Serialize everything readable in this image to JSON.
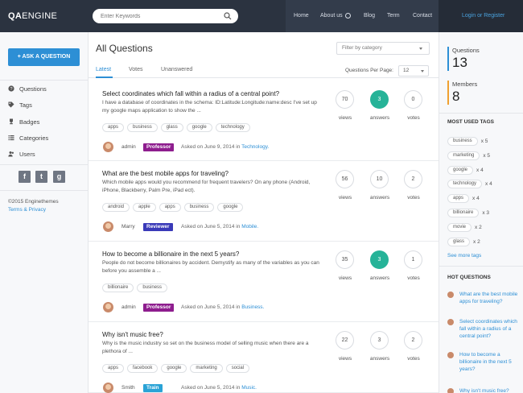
{
  "header": {
    "logo_bold": "QA",
    "logo_light": "ENGINE",
    "search_placeholder": "Enter Keywords",
    "nav": [
      "Home",
      "About us",
      "Blog",
      "Term",
      "Contact"
    ],
    "login": "Login or Register"
  },
  "sidebar": {
    "ask_button": "ASK A QUESTION",
    "items": [
      {
        "label": "Questions",
        "icon": "question-icon"
      },
      {
        "label": "Tags",
        "icon": "tag-icon"
      },
      {
        "label": "Badges",
        "icon": "trophy-icon"
      },
      {
        "label": "Categories",
        "icon": "list-icon"
      },
      {
        "label": "Users",
        "icon": "users-icon"
      }
    ],
    "social": [
      "f",
      "t",
      "g"
    ],
    "copyright": "©2015 Enginethemes",
    "terms": "Terms & Privacy"
  },
  "main": {
    "title": "All Questions",
    "filter_placeholder": "Filter by category",
    "tabs": [
      "Latest",
      "Votes",
      "Unanswered"
    ],
    "qpp_label": "Questions Per Page:",
    "qpp_value": "12",
    "questions": [
      {
        "title": "Select coordinates which fall within a radius of a central point?",
        "excerpt": "I have a database of coordinates in the schema: ID:Latitude:Longitude:name:desc I've set up my google maps application to show the ...",
        "tags": [
          "apps",
          "business",
          "glass",
          "google",
          "technology"
        ],
        "user": "admin",
        "role": "Professor",
        "role_color": "#8e1d8e",
        "asked": "Asked on June 9, 2014 in",
        "category": "Technology.",
        "views": "70",
        "answers": "3",
        "votes": "0",
        "answered": true
      },
      {
        "title": "What are the best mobile apps for traveling?",
        "excerpt": "Which mobile apps would you recommend for frequent travelers? On any phone (Android, iPhone, Blackberry, Palm Pre, iPad ect).",
        "tags": [
          "android",
          "apple",
          "apps",
          "business",
          "google"
        ],
        "user": "Marry",
        "role": "Reviewer",
        "role_color": "#3a3ab8",
        "asked": "Asked on June 5, 2014 in",
        "category": "Mobile.",
        "views": "56",
        "answers": "10",
        "votes": "2",
        "answered": false
      },
      {
        "title": "How to become a billionaire in the next 5 years?",
        "excerpt": "People do not become billionaires by accident. Demystify as many of the variables as you can before you assemble a ...",
        "tags": [
          "billionaire",
          "business"
        ],
        "user": "admin",
        "role": "Professor",
        "role_color": "#8e1d8e",
        "asked": "Asked on June 5, 2014 in",
        "category": "Business.",
        "views": "35",
        "answers": "3",
        "votes": "1",
        "answered": true
      },
      {
        "title": "Why isn't music free?",
        "excerpt": "Why is the music industry so set on the business model of selling music when there are a plethora of ...",
        "tags": [
          "apps",
          "facebook",
          "google",
          "marketing",
          "social"
        ],
        "user": "Smith",
        "role": "Train",
        "role_color": "#2aa3d6",
        "asked": "Asked on June 5, 2014 in",
        "category": "Music.",
        "views": "22",
        "answers": "3",
        "votes": "2",
        "answered": false
      }
    ],
    "stat_labels": [
      "views",
      "answers",
      "votes"
    ]
  },
  "right": {
    "questions_label": "Questions",
    "questions_value": "13",
    "members_label": "Members",
    "members_value": "8",
    "colors": {
      "questions": "#2d8fd5",
      "members": "#f0a030"
    },
    "tags_heading": "MOST USED TAGS",
    "tags": [
      {
        "name": "business",
        "count": "x 5"
      },
      {
        "name": "marketing",
        "count": "x 5"
      },
      {
        "name": "google",
        "count": "x 4"
      },
      {
        "name": "technology",
        "count": "x 4"
      },
      {
        "name": "apps",
        "count": "x 4"
      },
      {
        "name": "billionaire",
        "count": "x 3"
      },
      {
        "name": "movie",
        "count": "x 2"
      },
      {
        "name": "glass",
        "count": "x 2"
      }
    ],
    "see_more": "See more tags",
    "hot_heading": "HOT QUESTIONS",
    "hot": [
      "What are the best mobile apps for traveling?",
      "Select coordinates which fall within a radius of a central point?",
      "How to become a billionaire in the next 5 years?",
      "Why isn't music free?"
    ]
  }
}
